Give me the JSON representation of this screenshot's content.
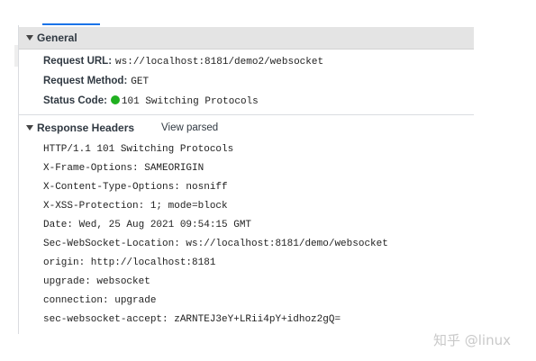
{
  "general": {
    "title": "General",
    "rows": [
      {
        "key": "Request URL:",
        "value": "ws://localhost:8181/demo2/websocket"
      },
      {
        "key": "Request Method:",
        "value": "GET"
      },
      {
        "key": "Status Code:",
        "value": "101 Switching Protocols"
      }
    ],
    "status_color": "#20b020"
  },
  "response_headers": {
    "title": "Response Headers",
    "view_parsed_label": "View parsed",
    "lines": [
      "HTTP/1.1 101 Switching Protocols",
      "X-Frame-Options: SAMEORIGIN",
      "X-Content-Type-Options: nosniff",
      "X-XSS-Protection: 1; mode=block",
      "Date: Wed, 25 Aug 2021 09:54:15 GMT",
      "Sec-WebSocket-Location: ws://localhost:8181/demo/websocket",
      "origin: http://localhost:8181",
      "upgrade: websocket",
      "connection: upgrade",
      "sec-websocket-accept: zARNTEJ3eY+LRii4pY+idhoz2gQ="
    ]
  },
  "watermark": "知乎 @linux",
  "colors": {
    "header_bg": "#e4e4e4",
    "accent": "#1a73e8",
    "text": "#303942"
  }
}
